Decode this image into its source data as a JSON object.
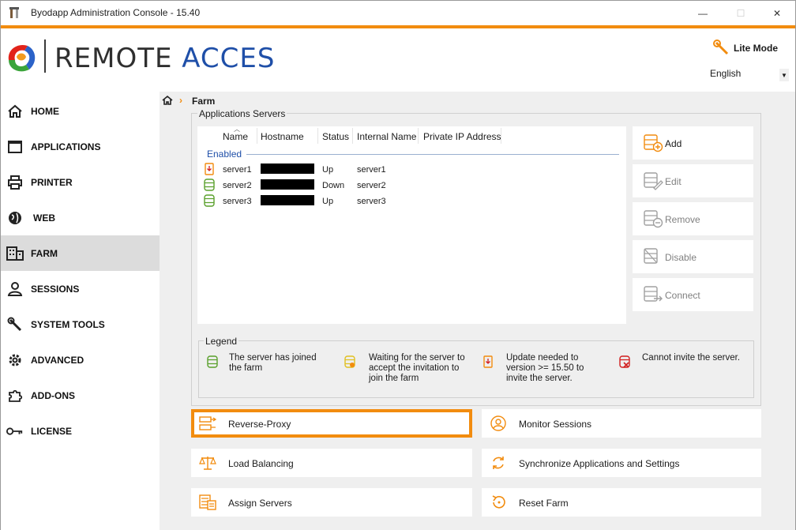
{
  "window": {
    "title": "Byodapp Administration Console - 15.40",
    "controls": {
      "minimize": "—",
      "maximize": "☐",
      "close": "✕"
    }
  },
  "header": {
    "logo_text_part1": "REMOTE ",
    "logo_text_part2": "ACCES",
    "lite_mode_label": "Lite Mode",
    "language": "English"
  },
  "sidebar": {
    "items": [
      {
        "label": "HOME",
        "icon": "home-icon"
      },
      {
        "label": "APPLICATIONS",
        "icon": "window-icon"
      },
      {
        "label": "PRINTER",
        "icon": "printer-icon"
      },
      {
        "label": "WEB",
        "icon": "globe-icon"
      },
      {
        "label": "FARM",
        "icon": "building-icon",
        "active": true
      },
      {
        "label": "SESSIONS",
        "icon": "user-icon"
      },
      {
        "label": "SYSTEM TOOLS",
        "icon": "wrench-icon"
      },
      {
        "label": "ADVANCED",
        "icon": "gear-icon"
      },
      {
        "label": "ADD-ONS",
        "icon": "puzzle-icon"
      },
      {
        "label": "LICENSE",
        "icon": "key-icon"
      }
    ]
  },
  "breadcrumb": {
    "current": "Farm"
  },
  "servers_panel": {
    "title": "Applications Servers",
    "columns": [
      "Name",
      "Hostname",
      "Status",
      "Internal Name",
      "Private IP Address"
    ],
    "group_label": "Enabled",
    "rows": [
      {
        "name": "server1",
        "hostname": "",
        "status": "Up",
        "internal_name": "server1",
        "private_ip": "",
        "icon": "server-update-icon"
      },
      {
        "name": "server2",
        "hostname": "",
        "status": "Down",
        "internal_name": "server2",
        "private_ip": "",
        "icon": "server-joined-icon"
      },
      {
        "name": "server3",
        "hostname": "",
        "status": "Up",
        "internal_name": "server3",
        "private_ip": "",
        "icon": "server-joined-icon"
      }
    ],
    "buttons": {
      "add": "Add",
      "edit": "Edit",
      "remove": "Remove",
      "disable": "Disable",
      "connect": "Connect"
    }
  },
  "legend": {
    "title": "Legend",
    "items": [
      {
        "text": "The server has joined the farm",
        "icon": "server-joined-icon"
      },
      {
        "text": "Waiting for the server to accept the invitation to join the farm",
        "icon": "server-waiting-icon"
      },
      {
        "text": "Update needed to version >= 15.50 to invite the server.",
        "icon": "server-update-icon"
      },
      {
        "text": "Cannot invite the server.",
        "icon": "server-error-icon"
      }
    ]
  },
  "actions": {
    "reverse_proxy": "Reverse-Proxy",
    "monitor_sessions": "Monitor Sessions",
    "load_balancing": "Load Balancing",
    "synchronize": "Synchronize Applications and Settings",
    "assign_servers": "Assign Servers",
    "reset_farm": "Reset Farm"
  },
  "colors": {
    "accent": "#f28c0f",
    "brand_blue": "#1f4fa8",
    "joined_green": "#5aa02c",
    "error_red": "#d21f1f",
    "sidebar_active": "#dcdcdc",
    "content_bg": "#efefef"
  }
}
